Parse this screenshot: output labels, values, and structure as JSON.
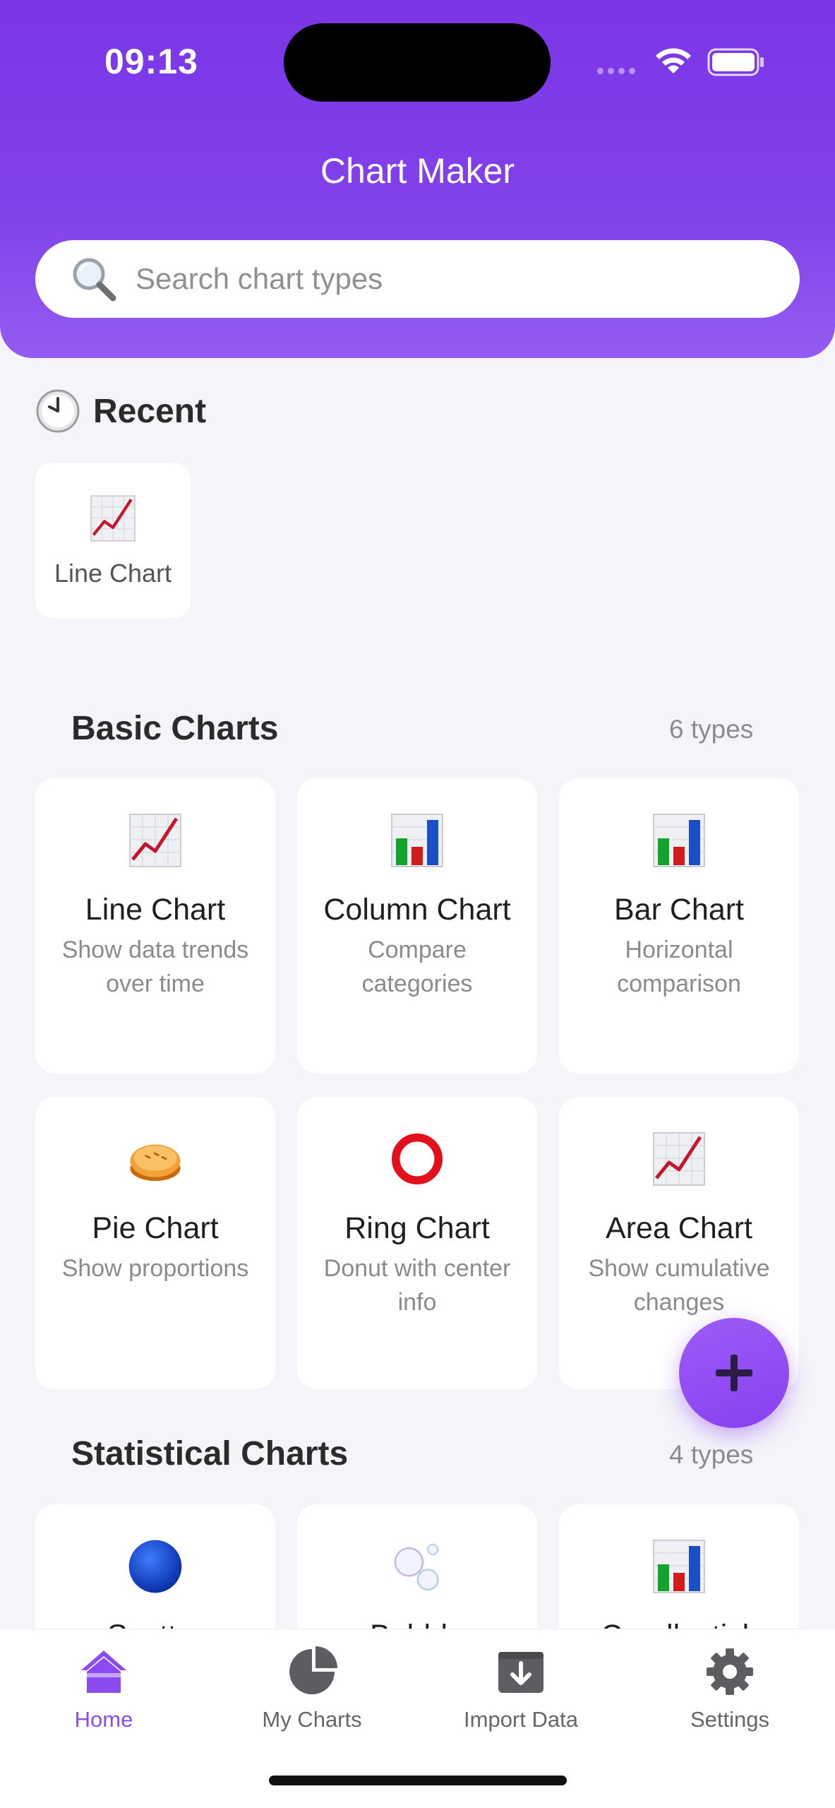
{
  "status_bar": {
    "time": "09:13"
  },
  "header": {
    "title": "Chart Maker",
    "search_placeholder": "Search chart types"
  },
  "recent": {
    "title": "Recent",
    "items": [
      {
        "label": "Line Chart",
        "icon": "line-chart-icon"
      }
    ]
  },
  "basic": {
    "title": "Basic Charts",
    "count": "6 types",
    "cards": [
      {
        "name": "Line Chart",
        "desc": "Show data trends over time",
        "icon": "line-chart-icon"
      },
      {
        "name": "Column Chart",
        "desc": "Compare categories",
        "icon": "column-chart-icon"
      },
      {
        "name": "Bar Chart",
        "desc": "Horizontal comparison",
        "icon": "bar-chart-icon"
      },
      {
        "name": "Pie Chart",
        "desc": "Show proportions",
        "icon": "pie-icon"
      },
      {
        "name": "Ring Chart",
        "desc": "Donut with center info",
        "icon": "ring-icon"
      },
      {
        "name": "Area Chart",
        "desc": "Show cumulative changes",
        "icon": "area-chart-icon"
      }
    ]
  },
  "statistical": {
    "title": "Statistical Charts",
    "count": "4 types",
    "cards": [
      {
        "name": "Scatter",
        "icon": "blue-circle-icon"
      },
      {
        "name": "Bubble",
        "icon": "bubbles-icon"
      },
      {
        "name": "Candlestick",
        "icon": "bar-chart-icon"
      }
    ]
  },
  "tabbar": {
    "items": [
      {
        "label": "Home",
        "icon": "home-icon",
        "active": true
      },
      {
        "label": "My Charts",
        "icon": "pie-chart-icon",
        "active": false
      },
      {
        "label": "Import Data",
        "icon": "import-icon",
        "active": false
      },
      {
        "label": "Settings",
        "icon": "gear-icon",
        "active": false
      }
    ]
  },
  "colors": {
    "accent": "#8a4cf0",
    "header": "#7b35e6",
    "background": "#f4f4f9"
  }
}
